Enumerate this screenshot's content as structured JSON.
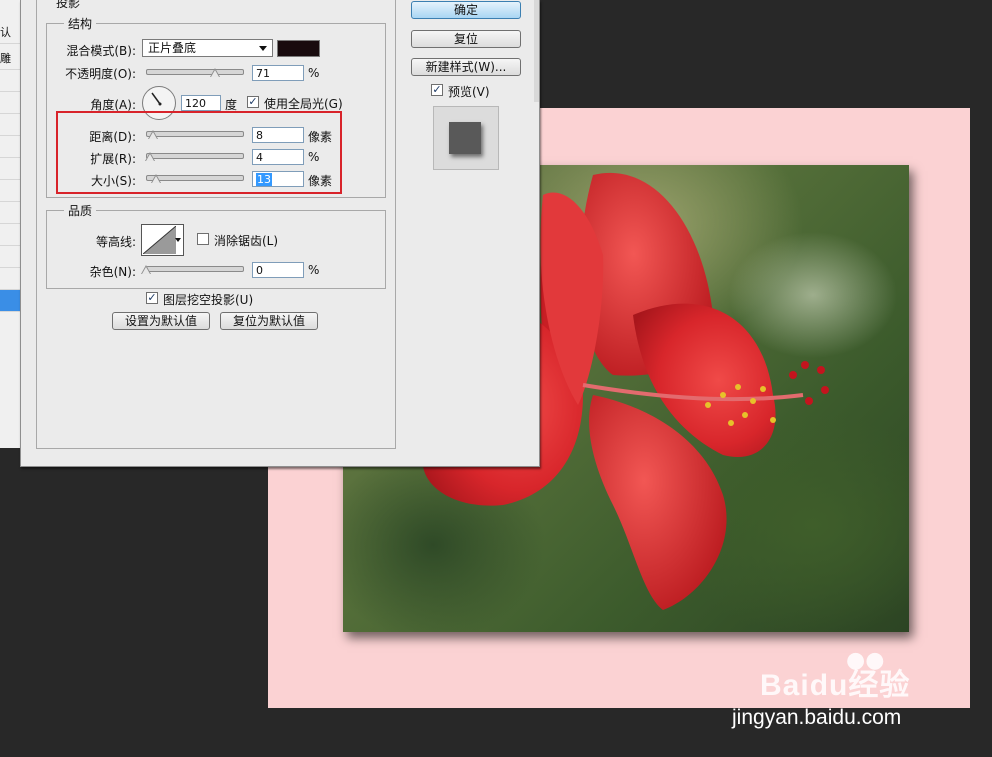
{
  "dialog": {
    "section_title": "投影",
    "structure": {
      "legend": "结构",
      "blend_mode_label": "混合模式(B):",
      "blend_mode_value": "正片叠底",
      "shadow_color": "#180b0e",
      "opacity_label": "不透明度(O):",
      "opacity_value": "71",
      "opacity_unit": "%",
      "opacity_level": 0.71,
      "angle_label": "角度(A):",
      "angle_value": "120",
      "angle_unit": "度",
      "global_light_label": "使用全局光(G)",
      "global_light_checked": true,
      "distance_label": "距离(D):",
      "distance_value": "8",
      "distance_unit": "像素",
      "spread_label": "扩展(R):",
      "spread_value": "4",
      "spread_unit": "%",
      "size_label": "大小(S):",
      "size_value": "13",
      "size_unit": "像素"
    },
    "quality": {
      "legend": "品质",
      "contour_label": "等高线:",
      "anti_alias_label": "消除锯齿(L)",
      "anti_alias_checked": false,
      "noise_label": "杂色(N):",
      "noise_value": "0",
      "noise_unit": "%"
    },
    "knockout_label": "图层挖空投影(U)",
    "knockout_checked": true,
    "make_default_label": "设置为默认值",
    "reset_default_label": "复位为默认值",
    "ok_label": "确定",
    "reset_label": "复位",
    "new_style_label": "新建样式(W)...",
    "preview_label": "预览(V)",
    "preview_checked": true
  },
  "left_strip": {
    "items": [
      "认",
      "雕"
    ]
  },
  "canvas": {
    "background_color": "#fbd2d3"
  },
  "watermark": {
    "logo_text": "Bai",
    "logo_text2": "du",
    "logo_cn": "经验",
    "url": "jingyan.baidu.com"
  }
}
